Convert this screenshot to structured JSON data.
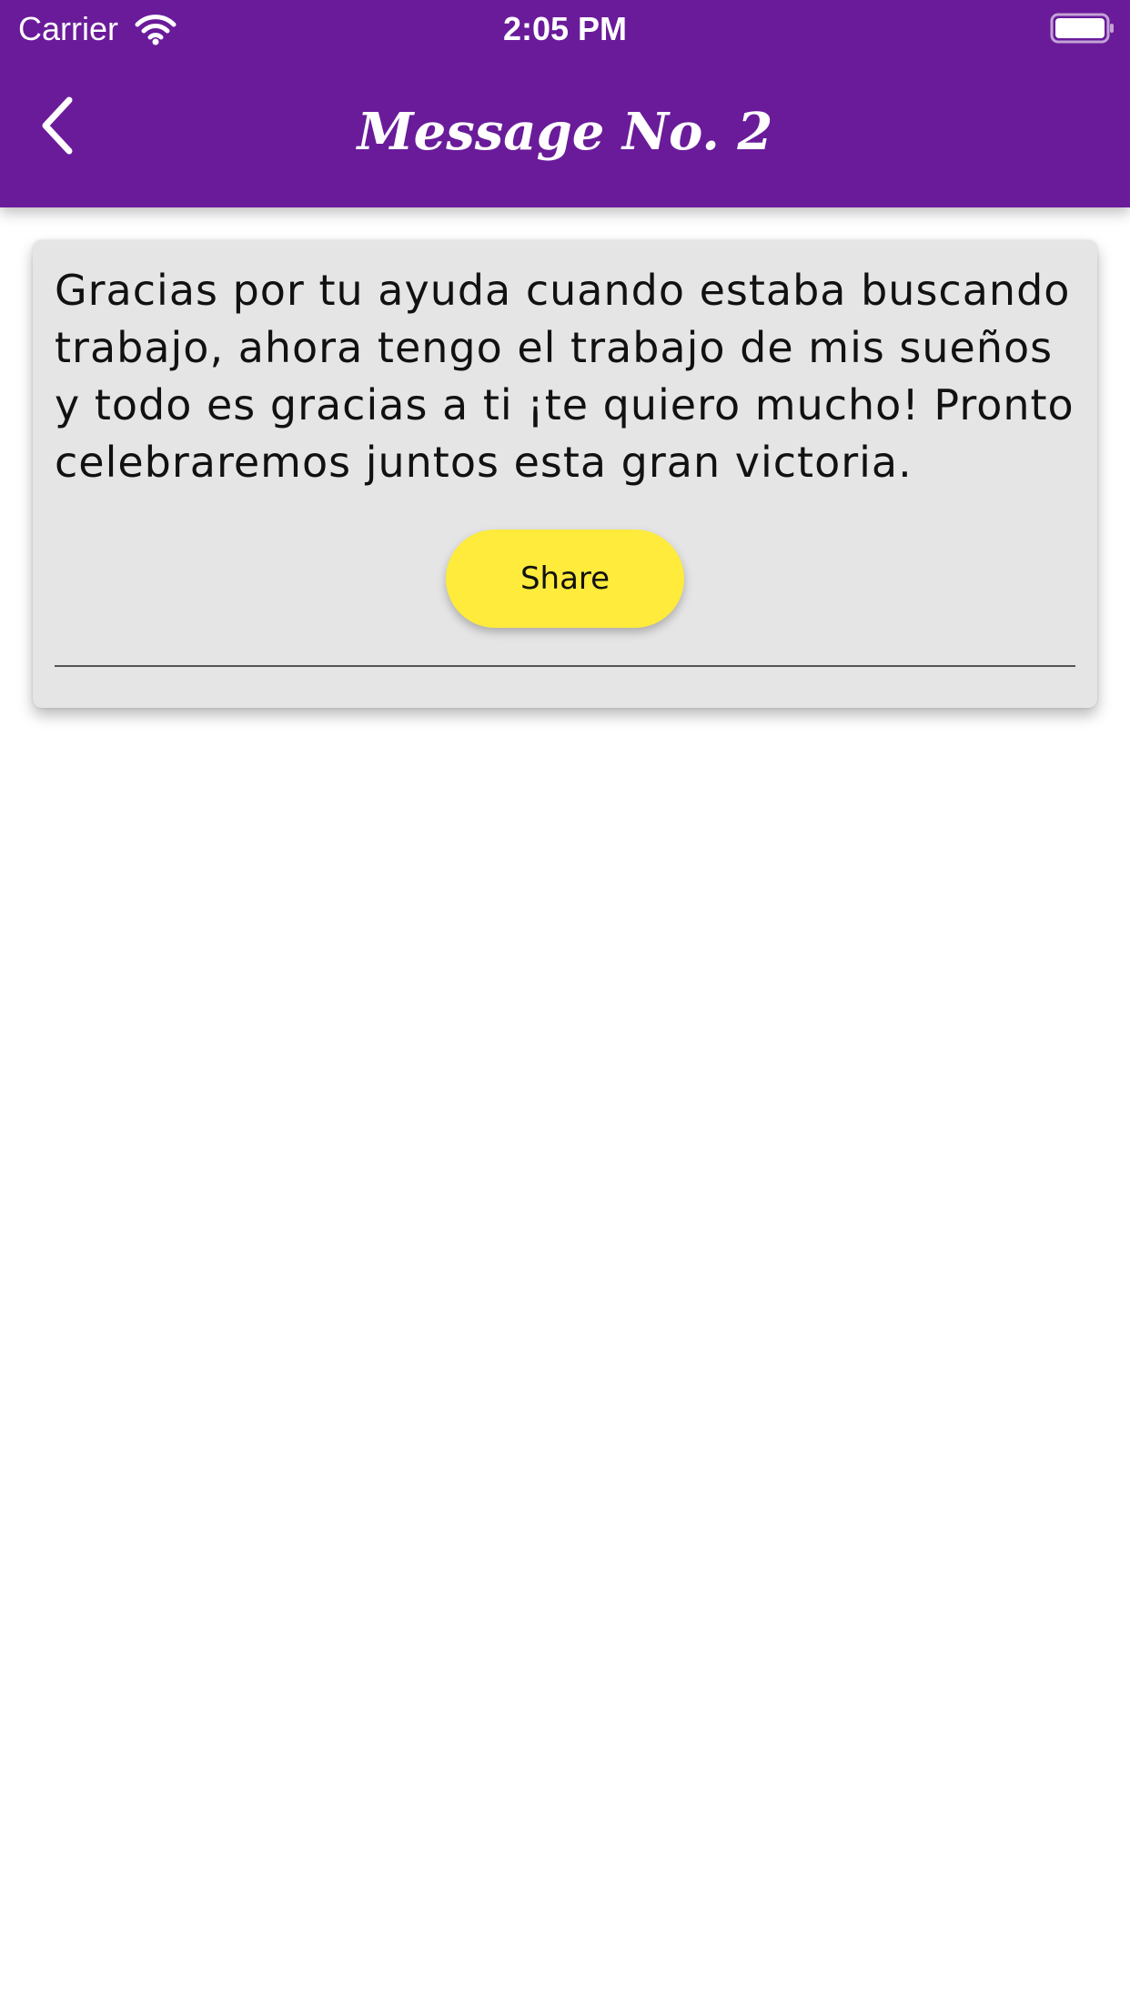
{
  "status_bar": {
    "carrier": "Carrier",
    "time": "2:05 PM",
    "wifi_icon": "wifi-icon",
    "battery_icon": "battery-icon"
  },
  "header": {
    "title": "Message No. 2",
    "back_icon": "chevron-left-icon",
    "background_color": "#6a1b9a"
  },
  "message": {
    "text": "Gracias por tu ayuda cuando estaba buscando trabajo, ahora tengo el trabajo de mis sueños y todo es gracias a ti ¡te quiero mucho! Pronto celebraremos juntos esta gran victoria.",
    "share_label": "Share",
    "share_color": "#ffeb3b",
    "card_color": "#e5e5e6"
  }
}
